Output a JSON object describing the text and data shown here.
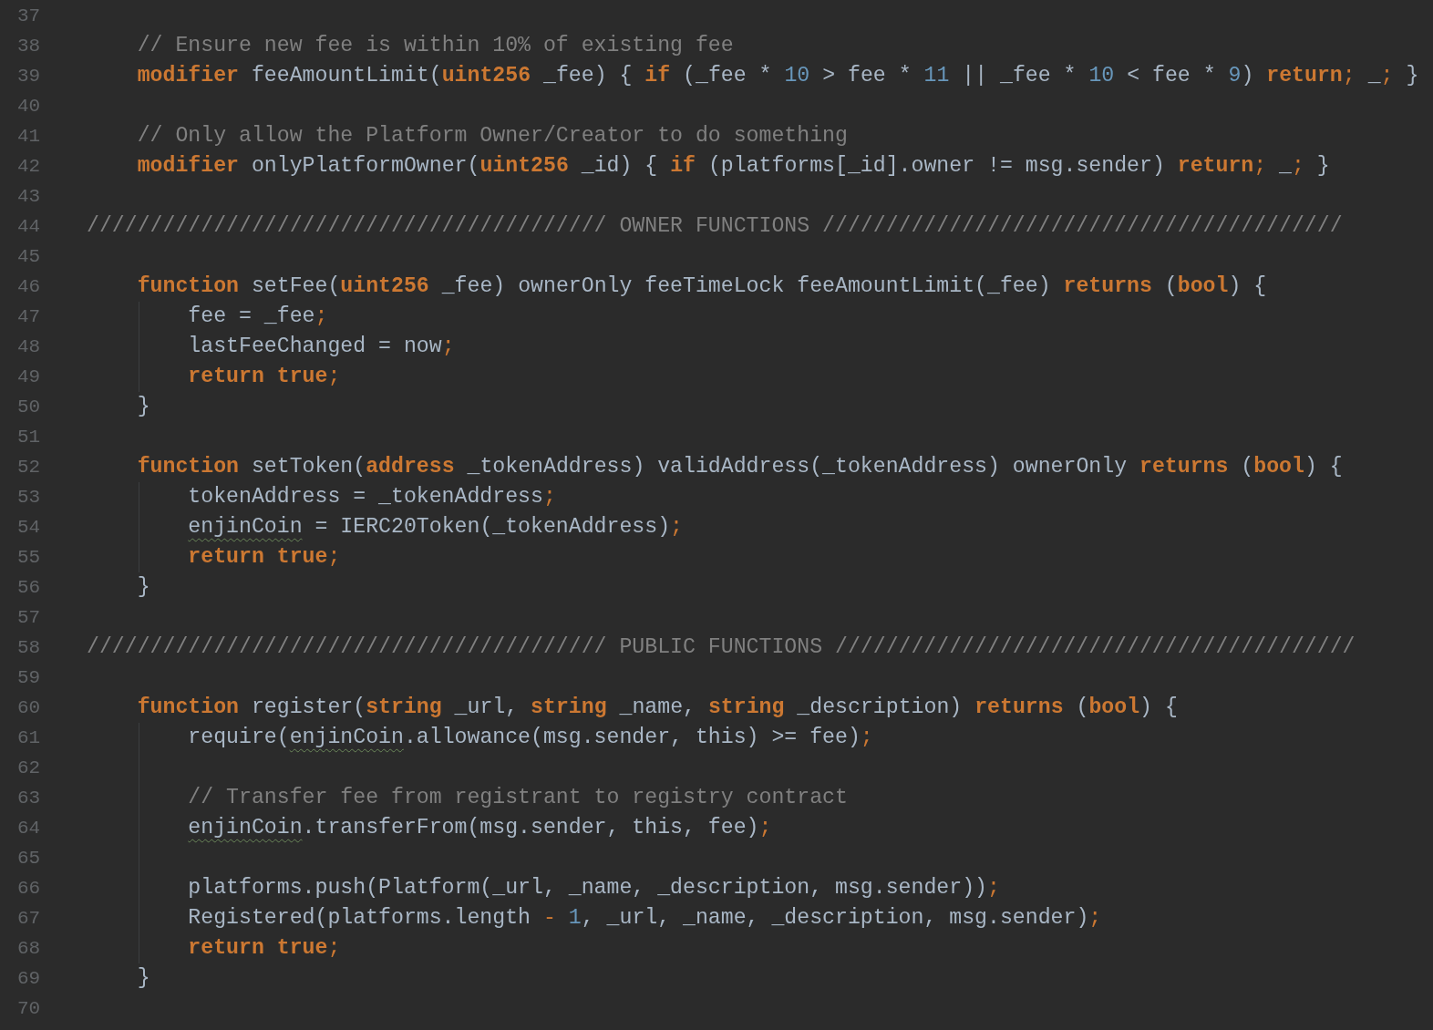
{
  "lines": [
    {
      "number": "37"
    },
    {
      "number": "38",
      "tokens": [
        {
          "kind": "comment",
          "text": "    // Ensure new fee is within 10% of existing fee"
        }
      ]
    },
    {
      "number": "39",
      "tokens": [
        {
          "kind": "keyword",
          "text": "    modifier"
        },
        {
          "kind": "plain",
          "text": " feeAmountLimit("
        },
        {
          "kind": "keyword",
          "text": "uint256"
        },
        {
          "kind": "plain",
          "text": " _fee) { "
        },
        {
          "kind": "keyword",
          "text": "if"
        },
        {
          "kind": "plain",
          "text": " (_fee * "
        },
        {
          "kind": "number",
          "text": "10"
        },
        {
          "kind": "plain",
          "text": " > fee * "
        },
        {
          "kind": "number",
          "text": "11"
        },
        {
          "kind": "plain",
          "text": " || _fee * "
        },
        {
          "kind": "number",
          "text": "10"
        },
        {
          "kind": "plain",
          "text": " < fee * "
        },
        {
          "kind": "number",
          "text": "9"
        },
        {
          "kind": "plain",
          "text": ") "
        },
        {
          "kind": "keyword",
          "text": "return"
        },
        {
          "kind": "punct",
          "text": ";"
        },
        {
          "kind": "plain",
          "text": " _; }"
        }
      ]
    },
    {
      "number": "40"
    },
    {
      "number": "41",
      "tokens": [
        {
          "kind": "comment",
          "text": "    // Only allow the Platform Owner/Creator to do something"
        }
      ]
    },
    {
      "number": "42",
      "tokens": [
        {
          "kind": "keyword",
          "text": "    modifier"
        },
        {
          "kind": "plain",
          "text": " onlyPlatformOwner("
        },
        {
          "kind": "keyword",
          "text": "uint256"
        },
        {
          "kind": "plain",
          "text": " _id) { "
        },
        {
          "kind": "keyword",
          "text": "if"
        },
        {
          "kind": "plain",
          "text": " (platforms[_id].owner != msg.sender) "
        },
        {
          "kind": "keyword",
          "text": "return"
        },
        {
          "kind": "punct",
          "text": ";"
        },
        {
          "kind": "plain",
          "text": " _; }"
        }
      ]
    },
    {
      "number": "43"
    },
    {
      "number": "44",
      "tokens": [
        {
          "kind": "comment",
          "text": "///////////////////////////////////////// OWNER FUNCTIONS /////////////////////////////////////////"
        }
      ]
    },
    {
      "number": "45"
    },
    {
      "number": "46",
      "tokens": [
        {
          "kind": "keyword",
          "text": "    function"
        },
        {
          "kind": "plain",
          "text": " setFee("
        },
        {
          "kind": "keyword",
          "text": "uint256"
        },
        {
          "kind": "plain",
          "text": " _fee) ownerOnly feeTimeLock feeAmountLimit(_fee) "
        },
        {
          "kind": "keyword",
          "text": "returns"
        },
        {
          "kind": "plain",
          "text": " ("
        },
        {
          "kind": "keyword",
          "text": "bool"
        },
        {
          "kind": "plain",
          "text": ") {"
        }
      ],
      "children": [
        {
          "number": "47",
          "tokens": [
            {
              "kind": "plain",
              "text": "        fee = _fee"
            },
            {
              "kind": "punct",
              "text": ";"
            }
          ]
        },
        {
          "number": "48",
          "tokens": [
            {
              "kind": "plain",
              "text": "        lastFeeChanged = now"
            },
            {
              "kind": "punct",
              "text": ";"
            }
          ]
        },
        {
          "number": "49",
          "tokens": [
            {
              "kind": "keyword",
              "text": "        return true"
            },
            {
              "kind": "punct",
              "text": ";"
            }
          ]
        }
      ]
    },
    {
      "number": "50",
      "tokens": [
        {
          "kind": "plain",
          "text": "    }"
        }
      ]
    },
    {
      "number": "51"
    },
    {
      "number": "52",
      "tokens": [
        {
          "kind": "keyword",
          "text": "    function"
        },
        {
          "kind": "plain",
          "text": " setToken("
        },
        {
          "kind": "keyword",
          "text": "address"
        },
        {
          "kind": "plain",
          "text": " _tokenAddress) validAddress(_tokenAddress) ownerOnly "
        },
        {
          "kind": "keyword",
          "text": "returns"
        },
        {
          "kind": "plain",
          "text": " ("
        },
        {
          "kind": "keyword",
          "text": "bool"
        },
        {
          "kind": "plain",
          "text": ") {"
        }
      ],
      "children": [
        {
          "number": "53",
          "tokens": [
            {
              "kind": "plain",
              "text": "        tokenAddress = _tokenAddress"
            },
            {
              "kind": "punct",
              "text": ";"
            }
          ]
        },
        {
          "number": "54",
          "tokens": [
            {
              "kind": "plain",
              "text": "        enjinCoin",
              "warning": true
            },
            {
              "kind": "plain",
              "text": " = IERC20Token(_tokenAddress)"
            },
            {
              "kind": "punct",
              "text": ";"
            }
          ]
        },
        {
          "number": "55",
          "tokens": [
            {
              "kind": "keyword",
              "text": "        return true"
            },
            {
              "kind": "punct",
              "text": ";"
            }
          ]
        }
      ]
    },
    {
      "number": "56",
      "tokens": [
        {
          "kind": "plain",
          "text": "    }"
        }
      ]
    },
    {
      "number": "57"
    },
    {
      "number": "58",
      "tokens": [
        {
          "kind": "comment",
          "text": "///////////////////////////////////////// PUBLIC FUNCTIONS /////////////////////////////////////////"
        }
      ]
    },
    {
      "number": "59"
    },
    {
      "number": "60",
      "tokens": [
        {
          "kind": "keyword",
          "text": "    function"
        },
        {
          "kind": "plain",
          "text": " register("
        },
        {
          "kind": "keyword",
          "text": "string"
        },
        {
          "kind": "plain",
          "text": " _url, "
        },
        {
          "kind": "keyword",
          "text": "string"
        },
        {
          "kind": "plain",
          "text": " _name, "
        },
        {
          "kind": "keyword",
          "text": "string"
        },
        {
          "kind": "plain",
          "text": " _description) "
        },
        {
          "kind": "keyword",
          "text": "returns"
        },
        {
          "kind": "plain",
          "text": " ("
        },
        {
          "kind": "keyword",
          "text": "bool"
        },
        {
          "kind": "plain",
          "text": ") {"
        }
      ],
      "children": [
        {
          "number": "61",
          "tokens": [
            {
              "kind": "plain",
              "text": "        require("
            },
            {
              "kind": "plain",
              "text": "enjinCoin",
              "warning": true
            },
            {
              "kind": "plain",
              "text": ".allowance(msg.sender, this) >= fee)"
            },
            {
              "kind": "punct",
              "text": ";"
            }
          ]
        },
        {
          "number": "62"
        },
        {
          "number": "63",
          "tokens": [
            {
              "kind": "comment",
              "text": "        // Transfer fee from registrant to registry contract"
            }
          ]
        },
        {
          "number": "64",
          "tokens": [
            {
              "kind": "plain",
              "text": "        enjinCoin",
              "warning": true
            },
            {
              "kind": "plain",
              "text": ".transferFrom(msg.sender, this, fee)"
            },
            {
              "kind": "punct",
              "text": ";"
            }
          ]
        },
        {
          "number": "65"
        },
        {
          "number": "66",
          "tokens": [
            {
              "kind": "plain",
              "text": "        platforms.push(Platform(_url, _name, _description, msg.sender))"
            },
            {
              "kind": "punct",
              "text": ";"
            }
          ]
        },
        {
          "number": "67",
          "tokens": [
            {
              "kind": "plain",
              "text": "        Registered(platforms.length "
            },
            {
              "kind": "punct",
              "text": "-"
            },
            {
              "kind": "number",
              "text": " 1"
            },
            {
              "kind": "plain",
              "text": ", _url, _name, _description, msg.sender)"
            },
            {
              "kind": "punct",
              "text": ";"
            }
          ]
        },
        {
          "number": "68",
          "tokens": [
            {
              "kind": "keyword",
              "text": "        return true"
            },
            {
              "kind": "punct",
              "text": ";"
            }
          ]
        }
      ]
    },
    {
      "number": "69",
      "tokens": [
        {
          "kind": "plain",
          "text": "    }"
        }
      ]
    },
    {
      "number": "70"
    }
  ]
}
